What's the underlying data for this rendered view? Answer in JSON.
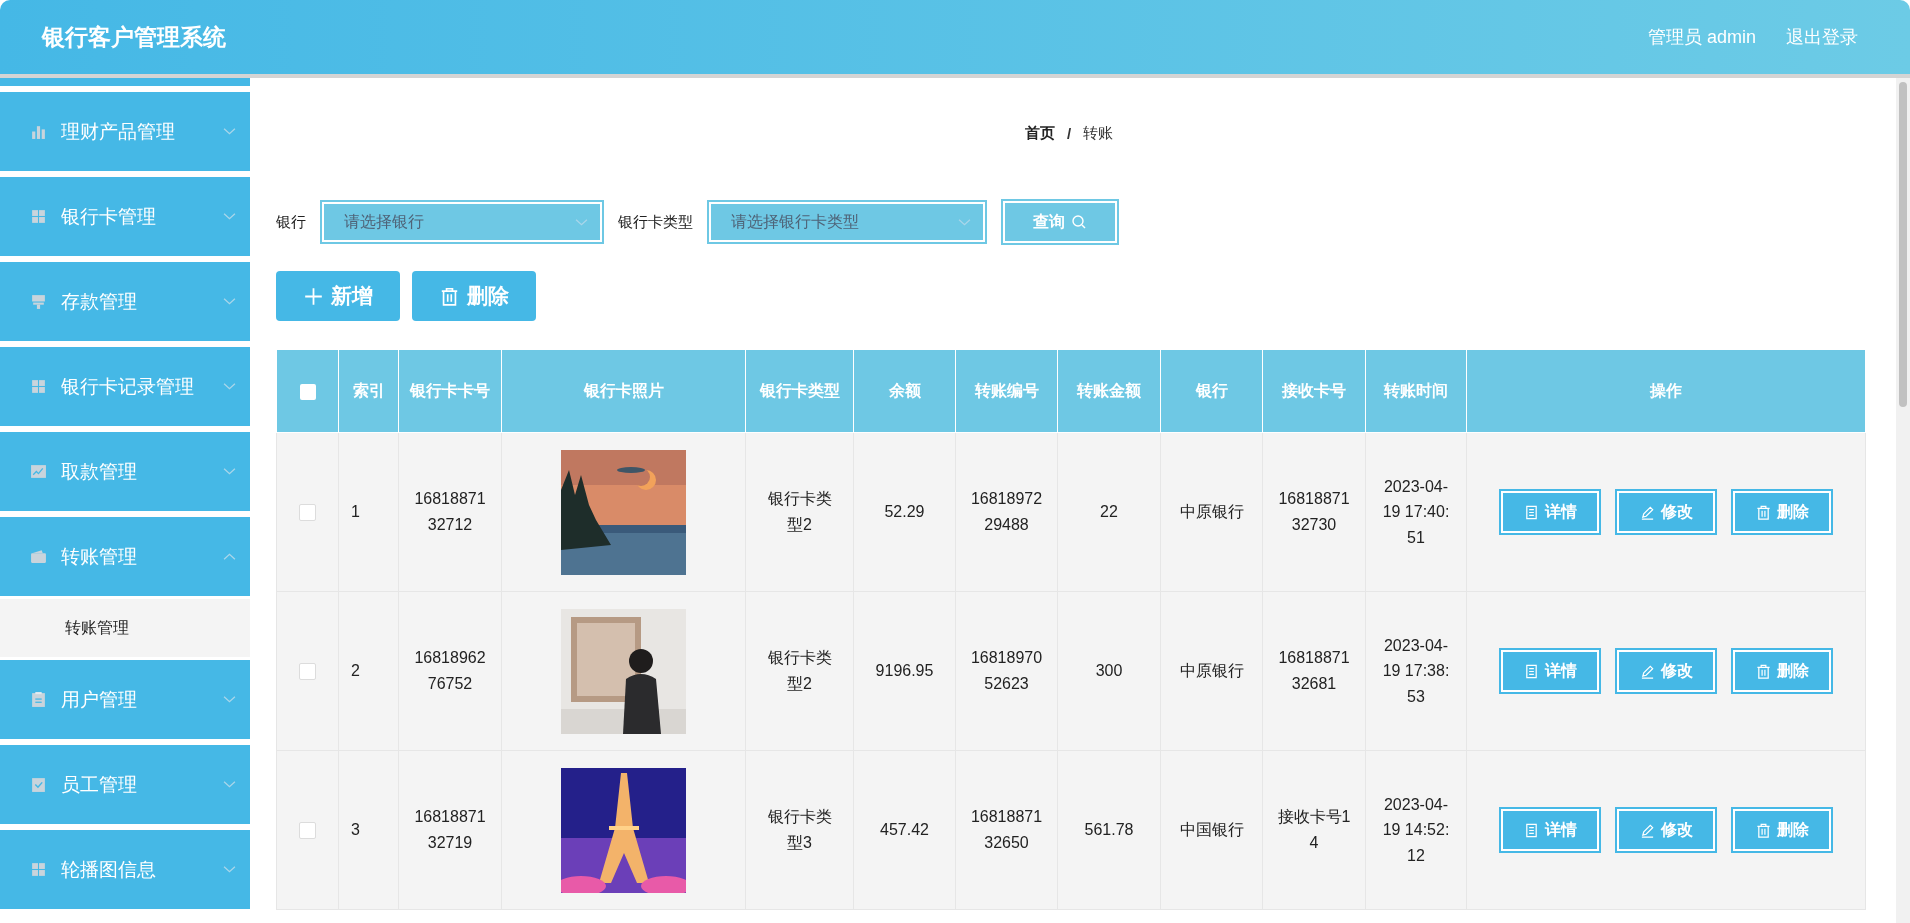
{
  "header": {
    "title": "银行客户管理系统",
    "user": "管理员 admin",
    "logout": "退出登录"
  },
  "sidebar": {
    "items": [
      {
        "label": "理财产品管理",
        "expanded": false
      },
      {
        "label": "银行卡管理",
        "expanded": false
      },
      {
        "label": "存款管理",
        "expanded": false
      },
      {
        "label": "银行卡记录管理",
        "expanded": false
      },
      {
        "label": "取款管理",
        "expanded": false
      },
      {
        "label": "转账管理",
        "expanded": true,
        "children": [
          {
            "label": "转账管理"
          }
        ]
      },
      {
        "label": "用户管理",
        "expanded": false
      },
      {
        "label": "员工管理",
        "expanded": false
      },
      {
        "label": "轮播图信息",
        "expanded": false
      }
    ]
  },
  "breadcrumb": {
    "separator": "/",
    "items": [
      "首页",
      "转账"
    ]
  },
  "filters": [
    {
      "label": "银行",
      "placeholder": "请选择银行"
    },
    {
      "label": "银行卡类型",
      "placeholder": "请选择银行卡类型"
    }
  ],
  "search_button": "查询",
  "toolbar": [
    {
      "kind": "add",
      "label": "新增"
    },
    {
      "kind": "delete",
      "label": "删除"
    }
  ],
  "table": {
    "select_all_checked": false,
    "columns": [
      "索引",
      "银行卡卡号",
      "银行卡照片",
      "银行卡类型",
      "余额",
      "转账编号",
      "转账金额",
      "银行",
      "接收卡号",
      "转账时间",
      "操作"
    ],
    "rows": [
      {
        "checked": false,
        "cells": [
          "1",
          "1681887132712",
          "",
          "银行卡类型2",
          "52.29",
          "1681897229488",
          "22",
          "中原银行",
          "1681887132730",
          "2023-04-19 17:40:51"
        ],
        "actions": [
          {
            "kind": "detail",
            "label": "详情"
          },
          {
            "kind": "edit",
            "label": "修改"
          },
          {
            "kind": "delete",
            "label": "删除"
          }
        ]
      },
      {
        "checked": false,
        "cells": [
          "2",
          "1681896276752",
          "",
          "银行卡类型2",
          "9196.95",
          "1681897052623",
          "300",
          "中原银行",
          "1681887132681",
          "2023-04-19 17:38:53"
        ],
        "actions": [
          {
            "kind": "detail",
            "label": "详情"
          },
          {
            "kind": "edit",
            "label": "修改"
          },
          {
            "kind": "delete",
            "label": "删除"
          }
        ]
      },
      {
        "checked": false,
        "cells": [
          "3",
          "1681887132719",
          "",
          "银行卡类型3",
          "457.42",
          "1681887132650",
          "561.78",
          "中国银行",
          "接收卡号14",
          "2023-04-19 14:52:12"
        ],
        "actions": [
          {
            "kind": "detail",
            "label": "详情"
          },
          {
            "kind": "edit",
            "label": "修改"
          },
          {
            "kind": "delete",
            "label": "删除"
          }
        ]
      }
    ]
  }
}
